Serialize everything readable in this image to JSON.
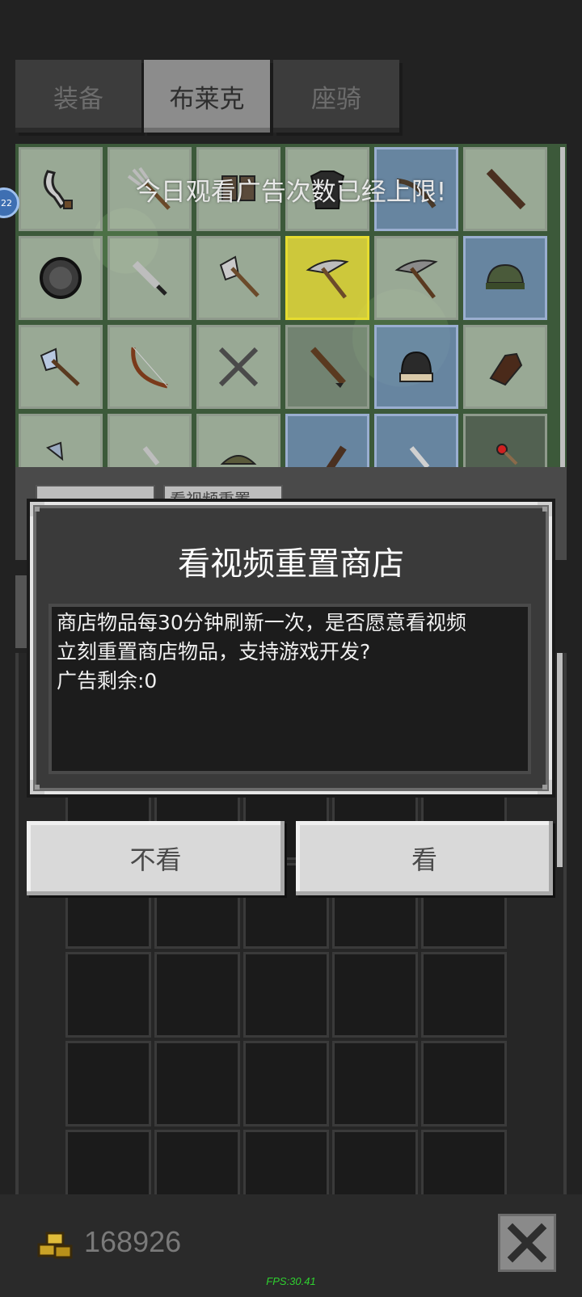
{
  "tabs": [
    {
      "label": "装备"
    },
    {
      "label": "布莱克"
    },
    {
      "label": "座骑"
    }
  ],
  "shop": {
    "notice": "今日观看广告次数已经上限!",
    "side_badge": "22",
    "partial_button_label": "看视频重置"
  },
  "dialog": {
    "title": "看视频重置商店",
    "message": "商店物品每30分钟刷新一次，是否愿意看视频\n立刻重置商店物品，支持游戏开发?\n广告剩余:0",
    "cancel_label": "不看",
    "confirm_label": "看"
  },
  "footer": {
    "coins": "168926",
    "fps": "FPS:30.41"
  },
  "icons": {
    "coins": "gold-coins-icon",
    "close": "close-x-icon"
  },
  "colors": {
    "highlight_cell": "#e6dc30",
    "rare_cell": "#7896c8",
    "fps_text": "#2fd02f"
  }
}
